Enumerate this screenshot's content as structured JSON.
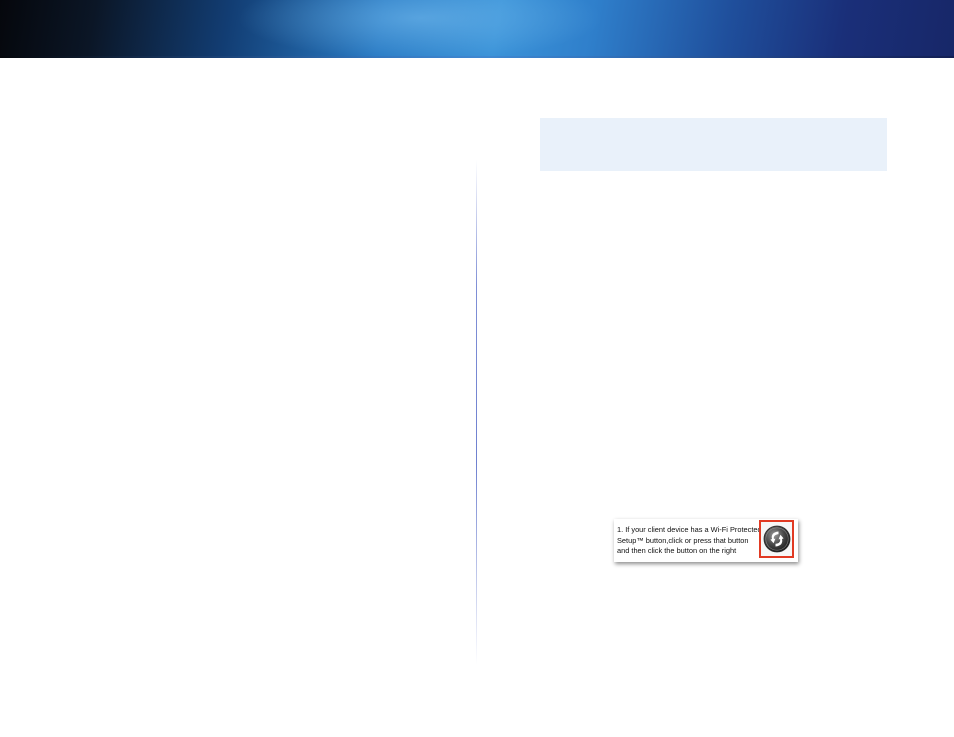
{
  "figure": {
    "instruction_text": "1. If your client device has a Wi-Fi Protected Setup™ button,click or press that button and then click the button on the right",
    "button_icon": "wps-icon",
    "button_highlight_color": "#e13a23"
  },
  "colors": {
    "note_background": "#e9f1fa",
    "divider": "#7f8fd6"
  }
}
